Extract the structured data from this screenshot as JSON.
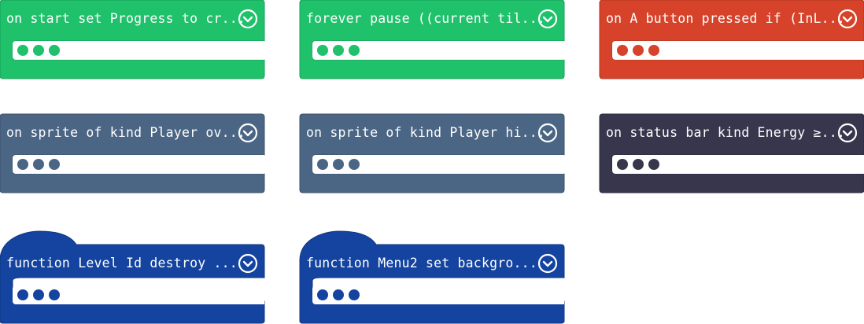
{
  "blocks": [
    {
      "id": "b1",
      "label": "on start set Progress to cr...",
      "color": "#1fc16b",
      "border": "#1a9e58",
      "kind": "event"
    },
    {
      "id": "b2",
      "label": "forever pause ((current til...",
      "color": "#1fc16b",
      "border": "#1a9e58",
      "kind": "event"
    },
    {
      "id": "b3",
      "label": "on A button pressed if (InL...",
      "color": "#d6432a",
      "border": "#b03420",
      "kind": "event"
    },
    {
      "id": "b4",
      "label": "on sprite of kind Player ov...",
      "color": "#4b6584",
      "border": "#3c526b",
      "kind": "event"
    },
    {
      "id": "b5",
      "label": "on sprite of kind Player hi...",
      "color": "#4b6584",
      "border": "#3c526b",
      "kind": "event"
    },
    {
      "id": "b6",
      "label": "on status bar kind Energy ≥...",
      "color": "#38364d",
      "border": "#2b2a3c",
      "kind": "event"
    },
    {
      "id": "b7",
      "label": "function Level Id  destroy ...",
      "color": "#1444a0",
      "border": "#0f3680",
      "kind": "function"
    },
    {
      "id": "b8",
      "label": "function Menu2  set backgro...",
      "color": "#1444a0",
      "border": "#0f3680",
      "kind": "function"
    }
  ],
  "icons": {
    "expand": "chevron-down-circle-icon",
    "more": "ellipsis-dots-icon"
  }
}
